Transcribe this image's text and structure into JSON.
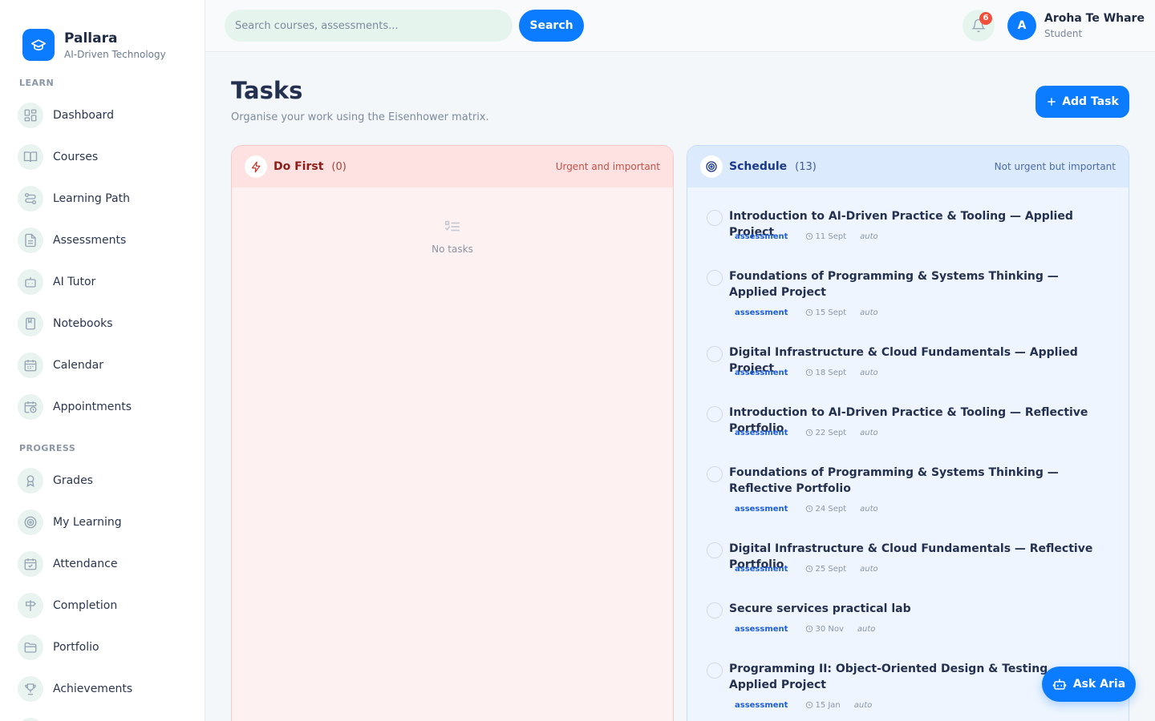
{
  "brand": {
    "name": "Pallara",
    "subtitle": "AI-Driven Technology"
  },
  "sidebar": {
    "learn_label": "LEARN",
    "learn_items": [
      {
        "label": "Dashboard",
        "icon": "dashboard-icon"
      },
      {
        "label": "Courses",
        "icon": "book-open-icon"
      },
      {
        "label": "Learning Path",
        "icon": "route-icon"
      },
      {
        "label": "Assessments",
        "icon": "document-icon"
      },
      {
        "label": "AI Tutor",
        "icon": "bot-icon"
      },
      {
        "label": "Notebooks",
        "icon": "notebook-icon"
      },
      {
        "label": "Calendar",
        "icon": "calendar-icon"
      },
      {
        "label": "Appointments",
        "icon": "calendar-clock-icon"
      }
    ],
    "progress_label": "PROGRESS",
    "progress_items": [
      {
        "label": "Grades",
        "icon": "award-icon"
      },
      {
        "label": "My Learning",
        "icon": "target-icon"
      },
      {
        "label": "Attendance",
        "icon": "calendar-check-icon"
      },
      {
        "label": "Completion",
        "icon": "signpost-icon"
      },
      {
        "label": "Portfolio",
        "icon": "folder-icon"
      },
      {
        "label": "Achievements",
        "icon": "trophy-icon"
      }
    ]
  },
  "header": {
    "search_placeholder": "Search courses, assessments...",
    "search_button": "Search",
    "notification_count": "6",
    "user_initial": "A",
    "user_name": "Aroha Te Whare",
    "user_role": "Student"
  },
  "page": {
    "title": "Tasks",
    "subtitle": "Organise your work using the Eisenhower matrix.",
    "add_button": "Add Task"
  },
  "quadrants": {
    "do_first": {
      "title": "Do First",
      "count": "(0)",
      "description": "Urgent and important",
      "empty_text": "No tasks"
    },
    "schedule": {
      "title": "Schedule",
      "count": "(13)",
      "description": "Not urgent but important",
      "tasks": [
        {
          "title": "Introduction to AI-Driven Practice & Tooling — Applied Project",
          "tag": "assessment",
          "due": "11 Sept",
          "source": "auto"
        },
        {
          "title": "Foundations of Programming & Systems Thinking — Applied Project",
          "tag": "assessment",
          "due": "15 Sept",
          "source": "auto"
        },
        {
          "title": "Digital Infrastructure & Cloud Fundamentals — Applied Project",
          "tag": "assessment",
          "due": "18 Sept",
          "source": "auto"
        },
        {
          "title": "Introduction to AI-Driven Practice & Tooling — Reflective Portfolio",
          "tag": "assessment",
          "due": "22 Sept",
          "source": "auto"
        },
        {
          "title": "Foundations of Programming & Systems Thinking — Reflective Portfolio",
          "tag": "assessment",
          "due": "24 Sept",
          "source": "auto"
        },
        {
          "title": "Digital Infrastructure & Cloud Fundamentals — Reflective Portfolio",
          "tag": "assessment",
          "due": "25 Sept",
          "source": "auto"
        },
        {
          "title": "Secure services practical lab",
          "tag": "assessment",
          "due": "30 Nov",
          "source": "auto"
        },
        {
          "title": "Programming II: Object-Oriented Design & Testing — Applied Project",
          "tag": "assessment",
          "due": "15 Jan",
          "source": "auto"
        }
      ]
    }
  },
  "aria_button": "Ask Aria",
  "colors": {
    "primary": "#0b7cff",
    "do_first_bg": "#fdf1f1",
    "schedule_bg": "#eef5fe",
    "badge": "#f24e3c"
  }
}
